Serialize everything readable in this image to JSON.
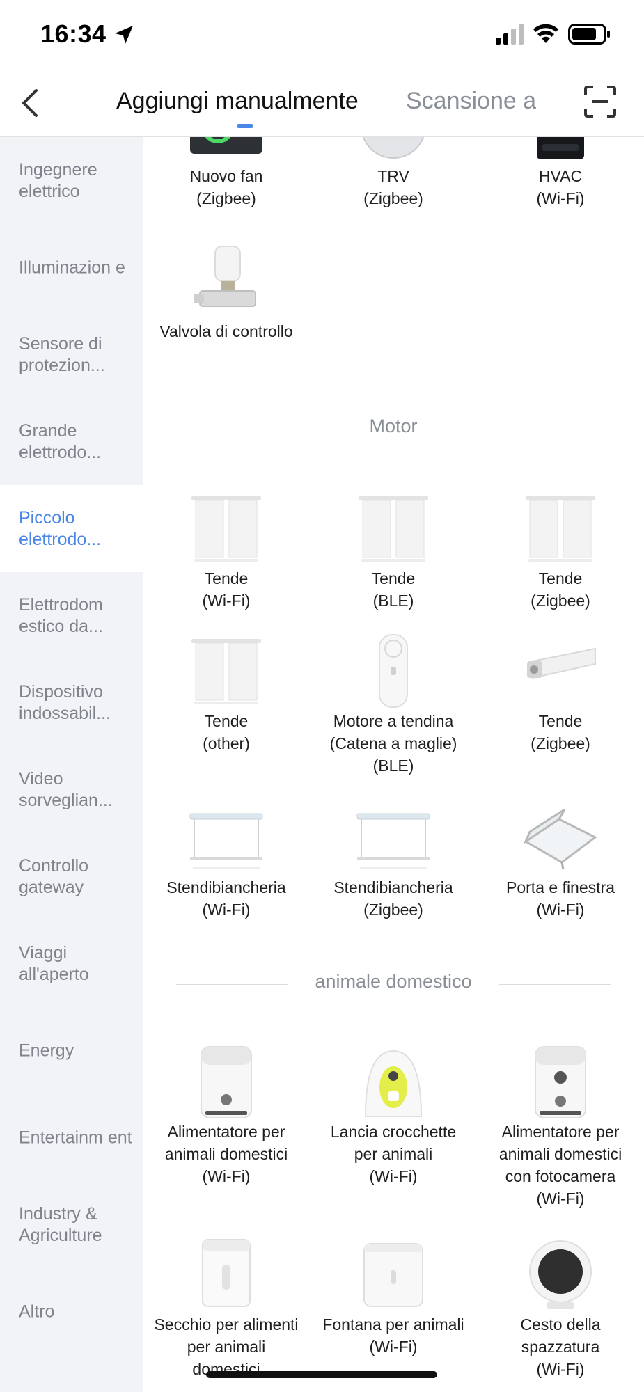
{
  "status": {
    "time": "16:34"
  },
  "header": {
    "tab_active": "Aggiungi manualmente",
    "tab_inactive": "Scansione a"
  },
  "sidebar": {
    "items": [
      {
        "label": "Ingegnere elettrico"
      },
      {
        "label": "Illuminazion e"
      },
      {
        "label": "Sensore di protezion..."
      },
      {
        "label": "Grande elettrodo..."
      },
      {
        "label": "Piccolo elettrodo..."
      },
      {
        "label": "Elettrodom estico da..."
      },
      {
        "label": "Dispositivo indossabil..."
      },
      {
        "label": "Video sorveglian..."
      },
      {
        "label": "Controllo gateway"
      },
      {
        "label": "Viaggi all'aperto"
      },
      {
        "label": "Energy"
      },
      {
        "label": "Entertainm ent"
      },
      {
        "label": "Industry & Agriculture"
      },
      {
        "label": "Altro"
      }
    ]
  },
  "sections": {
    "top": {
      "devices": [
        {
          "name": "Nuovo fan",
          "proto": "(Zigbee)",
          "icon": "fan-device-icon"
        },
        {
          "name": "TRV",
          "proto": "(Zigbee)",
          "icon": "trv-device-icon"
        },
        {
          "name": "HVAC",
          "proto": "(Wi-Fi)",
          "icon": "hvac-device-icon"
        },
        {
          "name": "Valvola di controllo",
          "icon": "valve-device-icon"
        }
      ]
    },
    "motor": {
      "title": "Motor",
      "devices": [
        {
          "name": "Tende",
          "proto": "(Wi-Fi)",
          "icon": "curtain-icon"
        },
        {
          "name": "Tende",
          "proto": "(BLE)",
          "icon": "curtain-icon"
        },
        {
          "name": "Tende",
          "proto": "(Zigbee)",
          "icon": "curtain-icon"
        },
        {
          "name": "Tende",
          "proto": "(other)",
          "icon": "curtain-icon"
        },
        {
          "name": "Motore a tendina",
          "name2": "(Catena a maglie)",
          "proto": "(BLE)",
          "icon": "chain-motor-icon"
        },
        {
          "name": "Tende",
          "proto": "(Zigbee)",
          "icon": "curtain-rail-icon"
        },
        {
          "name": "Stendibiancheria",
          "proto": "(Wi-Fi)",
          "icon": "clothes-rack-icon"
        },
        {
          "name": "Stendibiancheria",
          "proto": "(Zigbee)",
          "icon": "clothes-rack-icon"
        },
        {
          "name": "Porta e finestra",
          "proto": "(Wi-Fi)",
          "icon": "window-icon"
        }
      ]
    },
    "pets": {
      "title": "animale domestico",
      "devices": [
        {
          "name": "Alimentatore per",
          "name2": "animali domestici",
          "proto": "(Wi-Fi)",
          "icon": "pet-feeder-icon"
        },
        {
          "name": "Lancia crocchette",
          "name2": "per animali",
          "proto": "(Wi-Fi)",
          "icon": "treat-launcher-icon"
        },
        {
          "name": "Alimentatore per",
          "name2": "animali domestici",
          "name3": "con fotocamera",
          "proto": "(Wi-Fi)",
          "icon": "camera-feeder-icon"
        },
        {
          "name": "Secchio per alimenti",
          "name2": "per animali",
          "name3": "domestici",
          "icon": "food-bucket-icon"
        },
        {
          "name": "Fontana per animali",
          "proto": "(Wi-Fi)",
          "icon": "pet-fountain-icon"
        },
        {
          "name": "Cesto della",
          "name2": "spazzatura",
          "proto": "(Wi-Fi)",
          "icon": "trash-bin-icon"
        }
      ]
    }
  },
  "colors": {
    "accent": "#4a86e8",
    "sidebar_bg": "#f2f3f7",
    "muted": "#8a8f97"
  }
}
